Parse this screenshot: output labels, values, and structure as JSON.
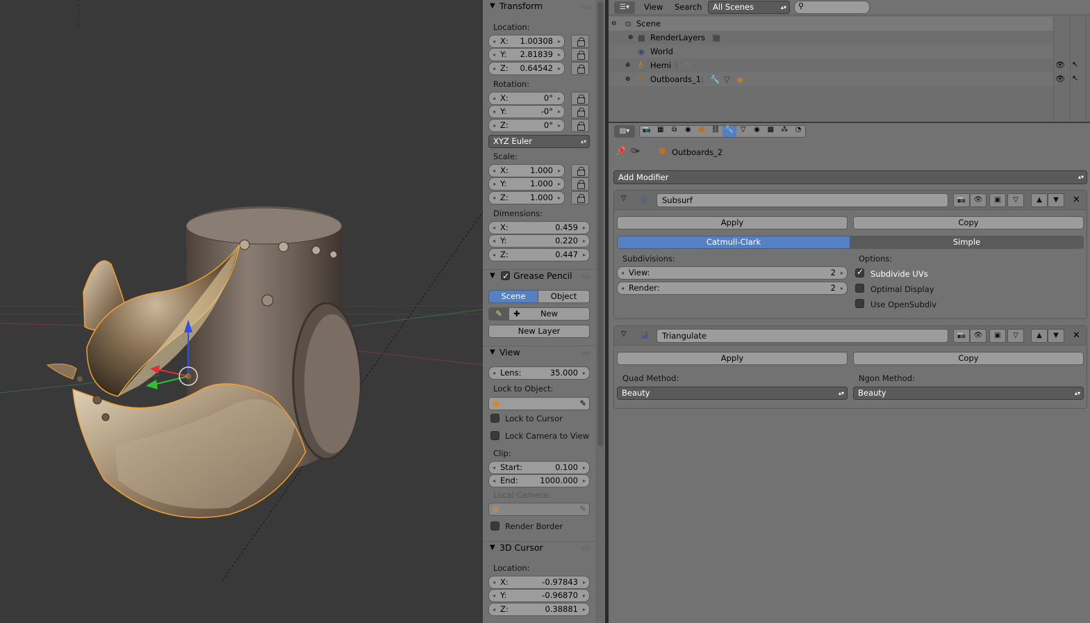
{
  "viewport": {
    "object_name": "Outboards_2"
  },
  "transform_panel": {
    "header": "Transform",
    "location_label": "Location:",
    "location": {
      "x": "1.00308",
      "y": "2.81839",
      "z": "0.64542"
    },
    "rotation_label": "Rotation:",
    "rotation": {
      "x": "0°",
      "y": "-0°",
      "z": "0°"
    },
    "rotation_mode": "XYZ Euler",
    "scale_label": "Scale:",
    "scale": {
      "x": "1.000",
      "y": "1.000",
      "z": "1.000"
    },
    "dimensions_label": "Dimensions:",
    "dimensions": {
      "x": "0.459",
      "y": "0.220",
      "z": "0.447"
    },
    "axis": {
      "x": "X:",
      "y": "Y:",
      "z": "Z:"
    }
  },
  "grease_pencil": {
    "header": "Grease Pencil",
    "scene_tab": "Scene",
    "object_tab": "Object",
    "new_label": "New",
    "new_layer_label": "New Layer"
  },
  "view_panel": {
    "header": "View",
    "lens_label": "Lens:",
    "lens_value": "35.000",
    "lock_to_object": "Lock to Object:",
    "lock_to_cursor": "Lock to Cursor",
    "lock_camera": "Lock Camera to View",
    "clip_label": "Clip:",
    "start_label": "Start:",
    "start_value": "0.100",
    "end_label": "End:",
    "end_value": "1000.000",
    "local_camera": "Local Camera:",
    "render_border": "Render Border"
  },
  "cursor_panel": {
    "header": "3D Cursor",
    "location_label": "Location:",
    "location": {
      "x": "-0.97843",
      "y": "-0.96870",
      "z": "0.38881"
    }
  },
  "outliner": {
    "view_menu": "View",
    "search_menu": "Search",
    "scenes_dropdown": "All Scenes",
    "rows": [
      {
        "label": "Scene"
      },
      {
        "label": "RenderLayers"
      },
      {
        "label": "World"
      },
      {
        "label": "Hemi"
      },
      {
        "label": "Outboards_1"
      }
    ]
  },
  "properties": {
    "breadcrumb_object": "Outboards_2",
    "add_modifier": "Add Modifier",
    "subsurf": {
      "name": "Subsurf",
      "apply": "Apply",
      "copy": "Copy",
      "catmull": "Catmull-Clark",
      "simple": "Simple",
      "subdivisions_label": "Subdivisions:",
      "view_label": "View:",
      "view_value": "2",
      "render_label": "Render:",
      "render_value": "2",
      "options_label": "Options:",
      "subdivide_uvs": "Subdivide UVs",
      "optimal_display": "Optimal Display",
      "use_opensubdiv": "Use OpenSubdiv"
    },
    "triangulate": {
      "name": "Triangulate",
      "apply": "Apply",
      "copy": "Copy",
      "quad_label": "Quad Method:",
      "quad_value": "Beauty",
      "ngon_label": "Ngon Method:",
      "ngon_value": "Beauty"
    }
  },
  "colors": {
    "accent": "#5680c2",
    "selection_outline": "#f0a030",
    "panel_bg": "#727272",
    "viewport_bg": "#393939"
  }
}
